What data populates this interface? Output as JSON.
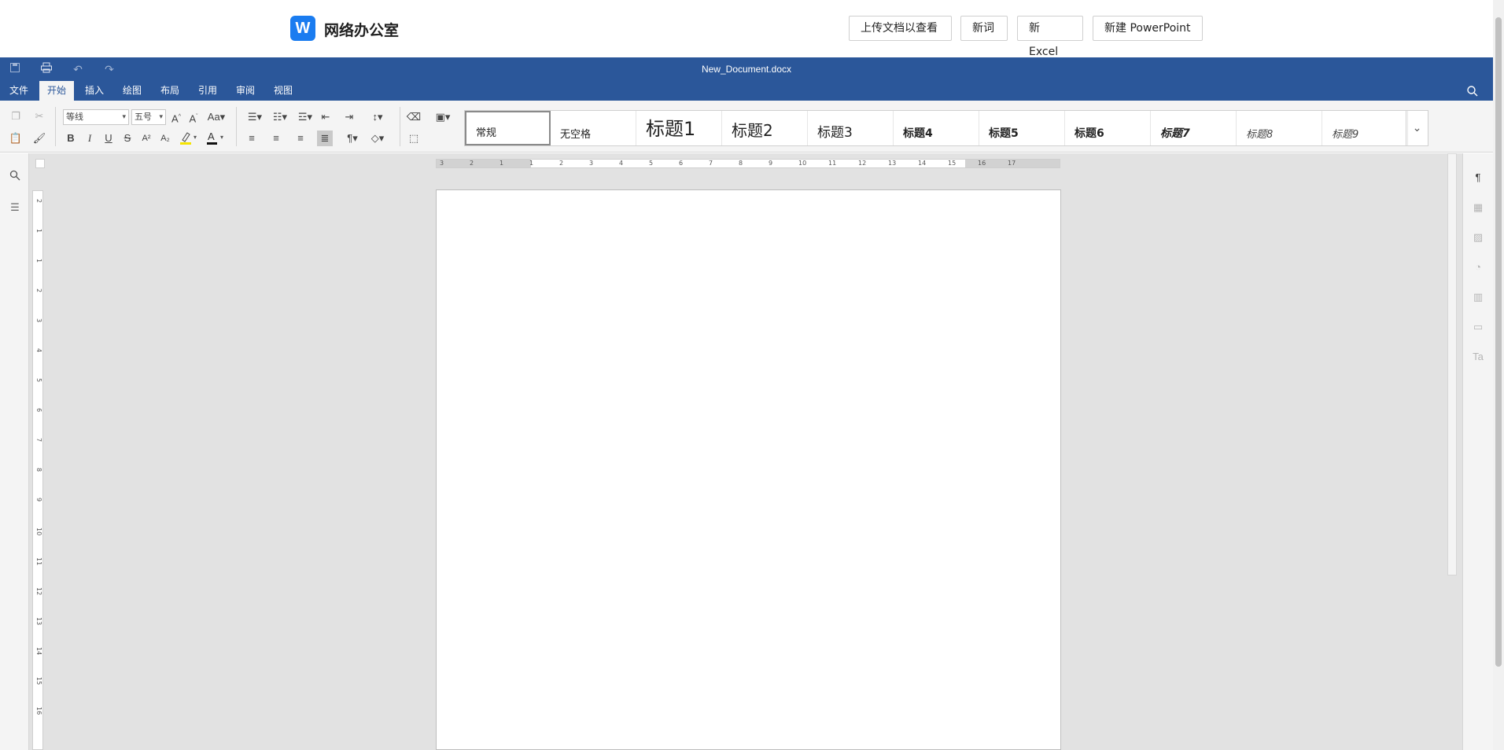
{
  "site": {
    "logo_letter": "W",
    "brand": "网络办公室",
    "buttons": [
      "上传文档以查看",
      "新词",
      "新 Excel",
      "新建 PowerPoint"
    ]
  },
  "editor": {
    "document_title": "New_Document.docx",
    "quick_access": [
      "save-icon",
      "print-icon",
      "undo-icon",
      "redo-icon"
    ],
    "menu_tabs": [
      "文件",
      "开始",
      "插入",
      "绘图",
      "布局",
      "引用",
      "审阅",
      "视图"
    ],
    "active_tab": "开始"
  },
  "ribbon": {
    "font_name": "等线",
    "font_size": "五号",
    "styles": [
      "常规",
      "无空格",
      "标题1",
      "标题2",
      "标题3",
      "标题4",
      "标题5",
      "标题6",
      "标题7",
      "标题8",
      "标题9"
    ],
    "selected_style": "常规"
  },
  "ruler": {
    "horizontal_numbers": [
      "3",
      "2",
      "1",
      "1",
      "2",
      "3",
      "4",
      "5",
      "6",
      "7",
      "8",
      "9",
      "10",
      "11",
      "12",
      "13",
      "14",
      "15",
      "16",
      "17"
    ],
    "vertical_numbers": [
      "2",
      "1",
      "1",
      "2",
      "3",
      "4",
      "5",
      "6",
      "7",
      "8",
      "9",
      "10",
      "11",
      "12",
      "13",
      "14",
      "15",
      "16"
    ]
  },
  "right_panel_icons": [
    "paragraph-icon",
    "table-icon",
    "image-icon",
    "shape-icon",
    "chart-icon",
    "header-footer-icon",
    "text-art-icon"
  ],
  "left_panel_icons": [
    "search-icon",
    "navigation-icon"
  ],
  "colors": {
    "header_blue": "#2b579a",
    "logo_blue": "#1a7cf0",
    "workspace_gray": "#e2e2e2"
  }
}
